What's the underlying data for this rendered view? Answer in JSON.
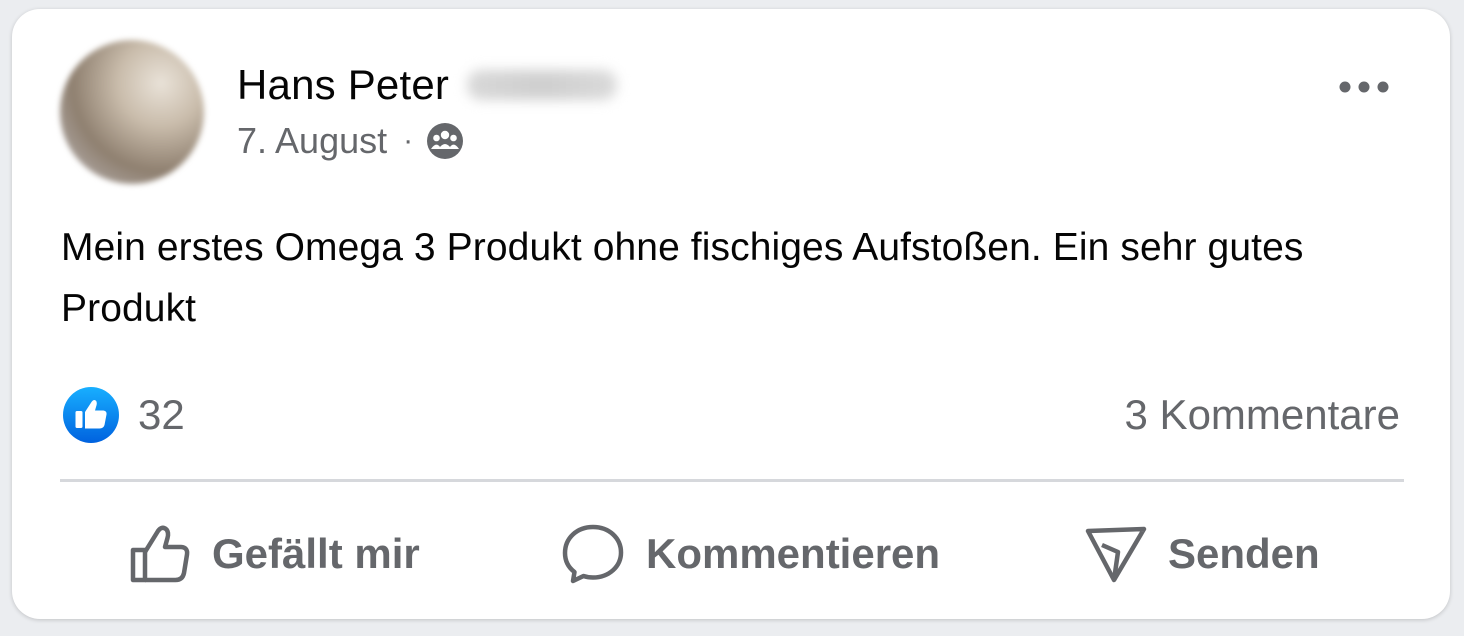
{
  "post": {
    "author_name": "Hans Peter",
    "date": "7. August",
    "separator": "·",
    "audience_icon": "group-icon",
    "text": "Mein erstes Omega 3 Produkt ohne fischiges Aufstoßen. Ein sehr gutes Produkt",
    "reaction_count": "32",
    "reaction_icon": "like-icon",
    "comments_label": "3 Kommentare"
  },
  "actions": {
    "like_label": "Gefällt mir",
    "comment_label": "Kommentieren",
    "send_label": "Senden"
  },
  "colors": {
    "like_blue": "#1877f2",
    "secondary_text": "#65676b",
    "primary_text": "#050505"
  }
}
